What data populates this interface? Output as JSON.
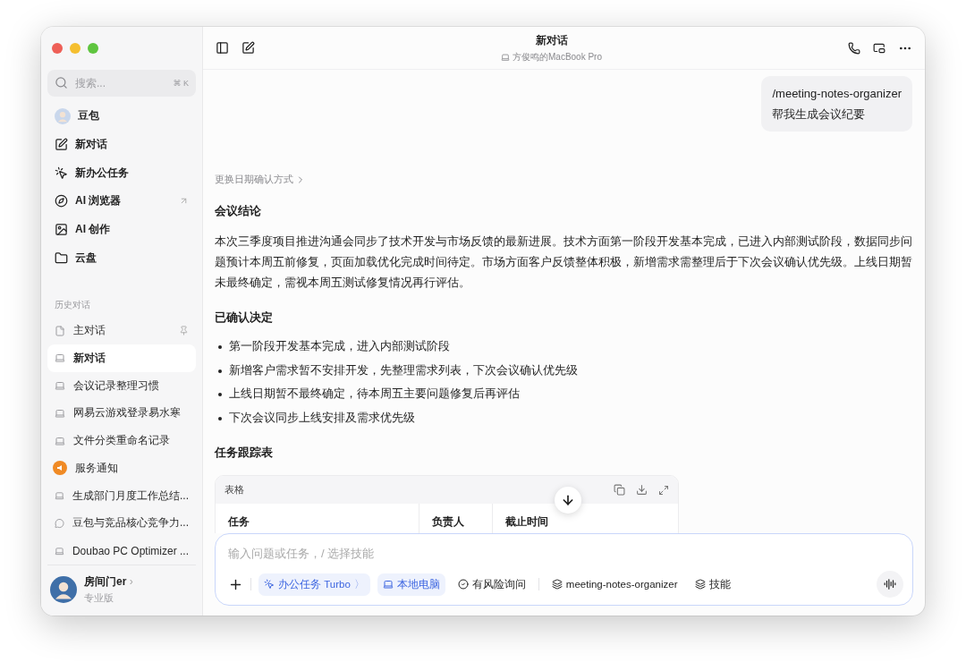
{
  "sidebar": {
    "search": {
      "placeholder": "搜索...",
      "shortcut": "⌘ K"
    },
    "nav": [
      {
        "kind": "avatar",
        "label": "豆包",
        "external": false
      },
      {
        "kind": "edit",
        "label": "新对话",
        "external": false
      },
      {
        "kind": "task",
        "label": "新办公任务",
        "external": false
      },
      {
        "kind": "browser",
        "label": "AI 浏览器",
        "external": true
      },
      {
        "kind": "image",
        "label": "AI 创作",
        "external": false
      },
      {
        "kind": "folder",
        "label": "云盘",
        "external": false
      }
    ],
    "history_heading": "历史对话",
    "history": [
      {
        "kind": "note",
        "label": "主对话",
        "pinned": true,
        "selected": false
      },
      {
        "kind": "laptop",
        "label": "新对话",
        "pinned": false,
        "selected": true
      },
      {
        "kind": "laptop",
        "label": "会议记录整理习惯",
        "pinned": false,
        "selected": false
      },
      {
        "kind": "laptop",
        "label": "网易云游戏登录易水寒",
        "pinned": false,
        "selected": false
      },
      {
        "kind": "laptop",
        "label": "文件分类重命名记录",
        "pinned": false,
        "selected": false
      },
      {
        "kind": "notice",
        "label": "服务通知",
        "pinned": false,
        "selected": false
      },
      {
        "kind": "laptop",
        "label": "生成部门月度工作总结...",
        "pinned": false,
        "selected": false
      },
      {
        "kind": "chat",
        "label": "豆包与竞品核心竞争力...",
        "pinned": false,
        "selected": false
      },
      {
        "kind": "laptop",
        "label": "Doubao PC Optimizer ...",
        "pinned": false,
        "selected": false
      }
    ],
    "user": {
      "name": "房间门er",
      "chevron": "›",
      "plan": "专业版"
    }
  },
  "header": {
    "title": "新对话",
    "device": "方俊鸣的MacBook Pro"
  },
  "user_message": [
    "/meeting-notes-organizer",
    "帮我生成会议纪要"
  ],
  "answer": {
    "link": "更换日期确认方式",
    "blocks": [
      {
        "kind": "heading",
        "text": "会议结论"
      },
      {
        "kind": "paragraph",
        "text": "本次三季度项目推进沟通会同步了技术开发与市场反馈的最新进展。技术方面第一阶段开发基本完成，已进入内部测试阶段，数据同步问题预计本周五前修复，页面加载优化完成时间待定。市场方面客户反馈整体积极，新增需求需整理后于下次会议确认优先级。上线日期暂未最终确定，需视本周五测试修复情况再行评估。"
      },
      {
        "kind": "heading",
        "text": "已确认决定"
      },
      {
        "kind": "bullets",
        "items": [
          "第一阶段开发基本完成，进入内部测试阶段",
          "新增客户需求暂不安排开发，先整理需求列表，下次会议确认优先级",
          "上线日期暂不最终确定，待本周五主要问题修复后再评估",
          "下次会议同步上线安排及需求优先级"
        ]
      },
      {
        "kind": "heading",
        "text": "任务跟踪表"
      },
      {
        "kind": "table",
        "title": "表格",
        "columns": [
          "任务",
          "负责人",
          "截止时间"
        ]
      }
    ]
  },
  "composer": {
    "placeholder": "输入问题或任务，/ 选择技能",
    "chips": [
      {
        "kind": "task",
        "label": "办公任务 Turbo",
        "chevron": "〉",
        "active": true
      },
      {
        "kind": "laptop",
        "label": "本地电脑",
        "active": true
      },
      {
        "kind": "check",
        "label": "有风险询问",
        "active": false
      },
      {
        "kind": "skill",
        "label": "meeting-notes-organizer",
        "active": false
      },
      {
        "kind": "skill",
        "label": "技能",
        "active": false
      }
    ]
  }
}
